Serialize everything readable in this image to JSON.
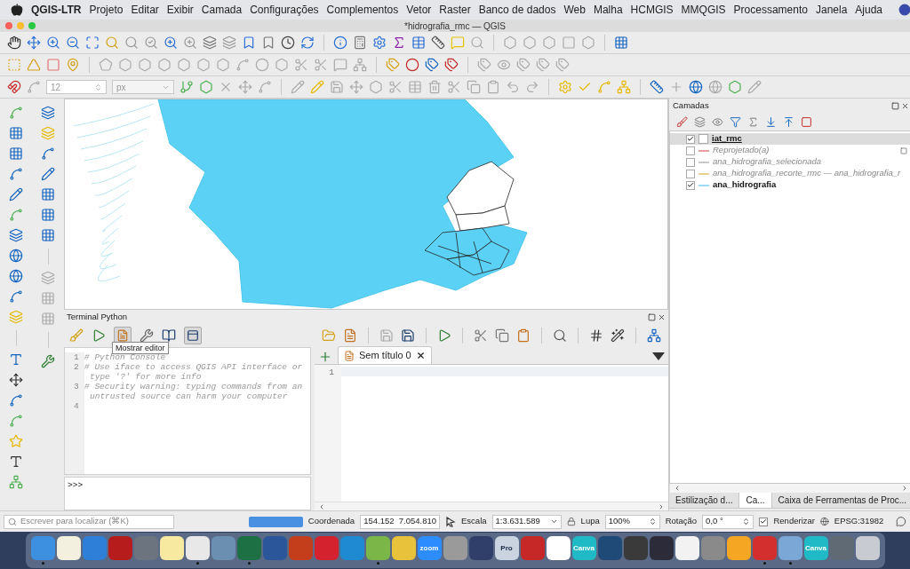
{
  "menu_bar": {
    "app": "QGIS-LTR",
    "items": [
      "Projeto",
      "Editar",
      "Exibir",
      "Camada",
      "Configurações",
      "Complementos",
      "Vetor",
      "Raster",
      "Banco de dados",
      "Web",
      "Malha",
      "HCMGIS",
      "MMQGIS",
      "Processamento",
      "Janela",
      "Ajuda"
    ]
  },
  "window": {
    "title": "*hidrografia_rmc — QGIS"
  },
  "snapping": {
    "tolerance": "12",
    "units": "px"
  },
  "layers_panel": {
    "title": "Camadas",
    "layers": [
      {
        "name": "iat_rmc",
        "checked": true,
        "selected": true,
        "color": "#ffffff",
        "indicator": false
      },
      {
        "name": "Reprojetado(a)",
        "checked": false,
        "selected": false,
        "color": "#e8a0a0",
        "indicator": true
      },
      {
        "name": "ana_hidrografia_selecionada",
        "checked": false,
        "selected": false,
        "color": "#c8c8c8",
        "indicator": false
      },
      {
        "name": "ana_hidrografia_recorte_rmc — ana_hidrografia_r",
        "checked": false,
        "selected": false,
        "color": "#e8d090",
        "indicator": false
      },
      {
        "name": "ana_hidrografia",
        "checked": true,
        "selected": false,
        "color": "#9fdcf5",
        "indicator": false
      }
    ],
    "tabs": [
      {
        "label": "Estilização d...",
        "selected": false
      },
      {
        "label": "Ca...",
        "selected": true
      },
      {
        "label": "Caixa de Ferramentas de Proc...",
        "selected": false
      }
    ]
  },
  "python_console": {
    "title": "Terminal Python",
    "tooltip": "Mostrar editor",
    "lines": [
      {
        "number": "1",
        "text": [
          "# Python Console"
        ]
      },
      {
        "number": "2",
        "text": [
          "# Use iface to access QGIS API interface or",
          "type '?' for more info"
        ]
      },
      {
        "number": "3",
        "text": [
          "# Security warning: typing commands from an",
          "untrusted source can harm your computer"
        ]
      },
      {
        "number": "4"
      }
    ],
    "prompt": ">>>",
    "editor_tab": "Sem título 0",
    "editor_lines": [
      "1"
    ]
  },
  "status_bar": {
    "search_placeholder": "Escrever para localizar (⌘K)",
    "progress": {
      "level": 1
    },
    "coordinate_label": "Coordenada",
    "coordinate": "154.152  7.054.810",
    "scale_label": "Escala",
    "scale": "1:3.631.589",
    "magnifier_label": "Lupa",
    "magnifier": "100%",
    "rotation_label": "Rotação",
    "rotation": "0,0 °",
    "render_label": "Renderizar",
    "render_checked": true,
    "crs": "EPSG:31982"
  },
  "dock": [
    {
      "color": "#3d8fe0",
      "running": true
    },
    {
      "color": "#f3f0e0",
      "running": false
    },
    {
      "color": "#2e7fd8",
      "running": false
    },
    {
      "color": "#b71c1c",
      "running": false
    },
    {
      "color": "#6c7480",
      "running": false
    },
    {
      "color": "#f7e9a0",
      "running": false
    },
    {
      "color": "#e8e8e8",
      "running": true
    },
    {
      "color": "#6a8fb0",
      "running": false
    },
    {
      "color": "#1d7044",
      "running": true
    },
    {
      "color": "#2b579a",
      "running": false
    },
    {
      "color": "#c43e1c",
      "running": false
    },
    {
      "color": "#d4232f",
      "running": false
    },
    {
      "color": "#1f8ad2",
      "running": false
    },
    {
      "color": "#7ab648",
      "running": true
    },
    {
      "color": "#e7c23a",
      "running": false
    },
    {
      "color": "#2d8cff",
      "label": "zoom",
      "running": false
    },
    {
      "color": "#9a9a9a",
      "running": false
    },
    {
      "color": "#2f3f6a",
      "running": false
    },
    {
      "color": "#c9d4e0",
      "label": "Pro",
      "running": false
    },
    {
      "color": "#c62828",
      "running": false
    },
    {
      "color": "#ffffff",
      "running": false
    },
    {
      "color": "#20b9c6",
      "label": "Canva",
      "running": false
    },
    {
      "color": "#1f4a78",
      "running": false
    },
    {
      "color": "#3a3a3a",
      "running": false
    },
    {
      "color": "#2b2b3a",
      "running": false
    },
    {
      "color": "#f2f2f2",
      "running": false
    },
    {
      "color": "#8a8a8a",
      "running": false
    },
    {
      "color": "#f5a623",
      "running": false
    },
    {
      "color": "#d32f2f",
      "running": true
    },
    {
      "color": "#7ba7d6",
      "running": true
    },
    {
      "color": "#20b9c6",
      "label": "Canva",
      "running": false
    },
    {
      "color": "#606a74",
      "running": false
    },
    {
      "color": "#c8ccd2",
      "running": false
    }
  ]
}
